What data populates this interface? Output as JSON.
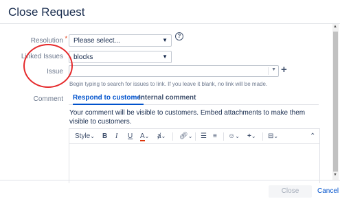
{
  "dialog": {
    "title": "Close Request"
  },
  "form": {
    "resolution": {
      "label": "Resolution",
      "required_mark": "*",
      "value": "Please select..."
    },
    "linked_issues": {
      "label": "Linked Issues",
      "value": "blocks"
    },
    "issue": {
      "label": "Issue",
      "value": "",
      "hint": "Begin typing to search for issues to link. If you leave it blank, no link will be made."
    },
    "comment": {
      "label": "Comment",
      "tabs": [
        {
          "label": "Respond to customer",
          "active": true
        },
        {
          "label": "Internal comment",
          "active": false
        }
      ],
      "description": "Your comment will be visible to customers. Embed attachments to make them visible to customers.",
      "toolbar": {
        "style_label": "Style",
        "bold": "B",
        "italic": "I",
        "underline": "U",
        "text_color": "A"
      }
    }
  },
  "footer": {
    "submit_label": "Close Request",
    "cancel_label": "Cancel"
  },
  "colors": {
    "accent": "#0052cc",
    "required": "#de350b",
    "annotation": "#e5292b"
  }
}
